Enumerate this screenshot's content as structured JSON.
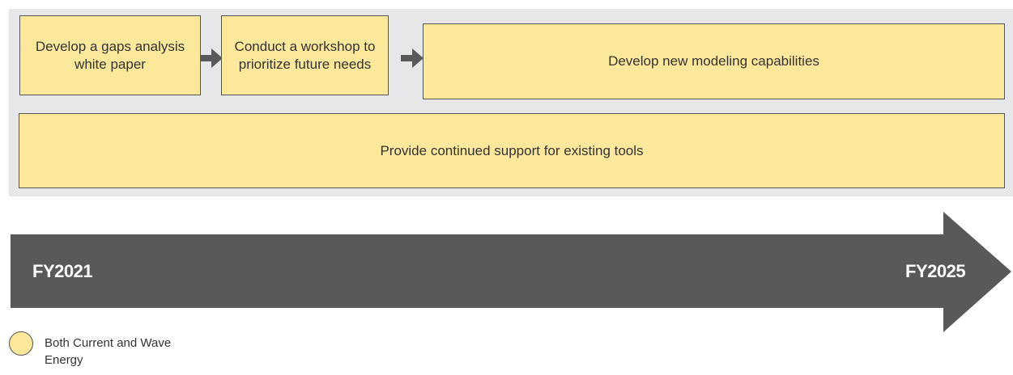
{
  "steps": [
    {
      "label": "Develop a gaps analysis white paper"
    },
    {
      "label": "Conduct a workshop to prioritize future needs"
    },
    {
      "label": "Develop new modeling capabilities"
    }
  ],
  "ongoing": {
    "label": "Provide continued support for existing tools"
  },
  "timeline": {
    "start_label": "FY2021",
    "end_label": "FY2025"
  },
  "legend": {
    "label": "Both Current and Wave Energy"
  },
  "colors": {
    "panel_background": "#e6e7e8",
    "box_fill": "#fbe89b",
    "box_border": "#555556",
    "timeline_arrow": "#58595b",
    "connector_arrow": "#58595b"
  },
  "icons": {
    "step_connector": "right-arrow-icon",
    "timeline": "timeline-arrow-icon"
  }
}
